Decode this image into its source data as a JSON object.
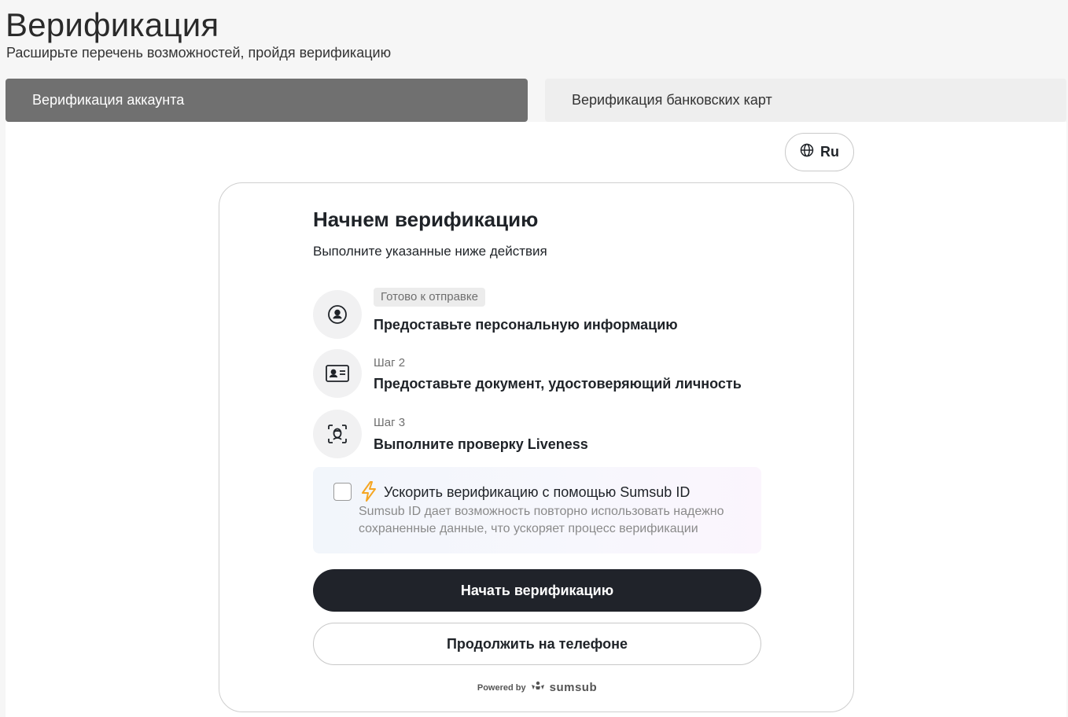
{
  "header": {
    "title": "Верификация",
    "subtitle": "Расширьте перечень возможностей, пройдя верификацию"
  },
  "tabs": [
    {
      "label": "Верификация аккаунта",
      "active": true
    },
    {
      "label": "Верификация банковских карт",
      "active": false
    }
  ],
  "language": {
    "label": "Ru",
    "icon": "globe-icon"
  },
  "card": {
    "title": "Начнем верификацию",
    "subtitle": "Выполните указанные ниже действия",
    "steps": [
      {
        "tag": "Готово к отправке",
        "label": "Предоставьте персональную информацию",
        "icon": "person-circle-icon"
      },
      {
        "tag": "Шаг 2",
        "label": "Предоставьте документ, удостоверяющий личность",
        "icon": "id-card-icon"
      },
      {
        "tag": "Шаг 3",
        "label": "Выполните проверку Liveness",
        "icon": "face-scan-icon"
      }
    ],
    "sumsub_id": {
      "title": "Ускорить верификацию с помощью Sumsub ID",
      "description": "Sumsub ID дает возможность повторно использовать надежно сохраненные данные, что ускоряет процесс верификации",
      "checked": false,
      "icon": "lightning-icon"
    },
    "primary_button": "Начать верификацию",
    "secondary_button": "Продолжить на телефоне",
    "footer": {
      "powered_by": "Powered by",
      "brand": "sumsub"
    }
  },
  "colors": {
    "active_tab": "#707070",
    "inactive_tab": "#eeeeee",
    "primary_button": "#20232a",
    "accent_bolt": "#f5a623"
  }
}
